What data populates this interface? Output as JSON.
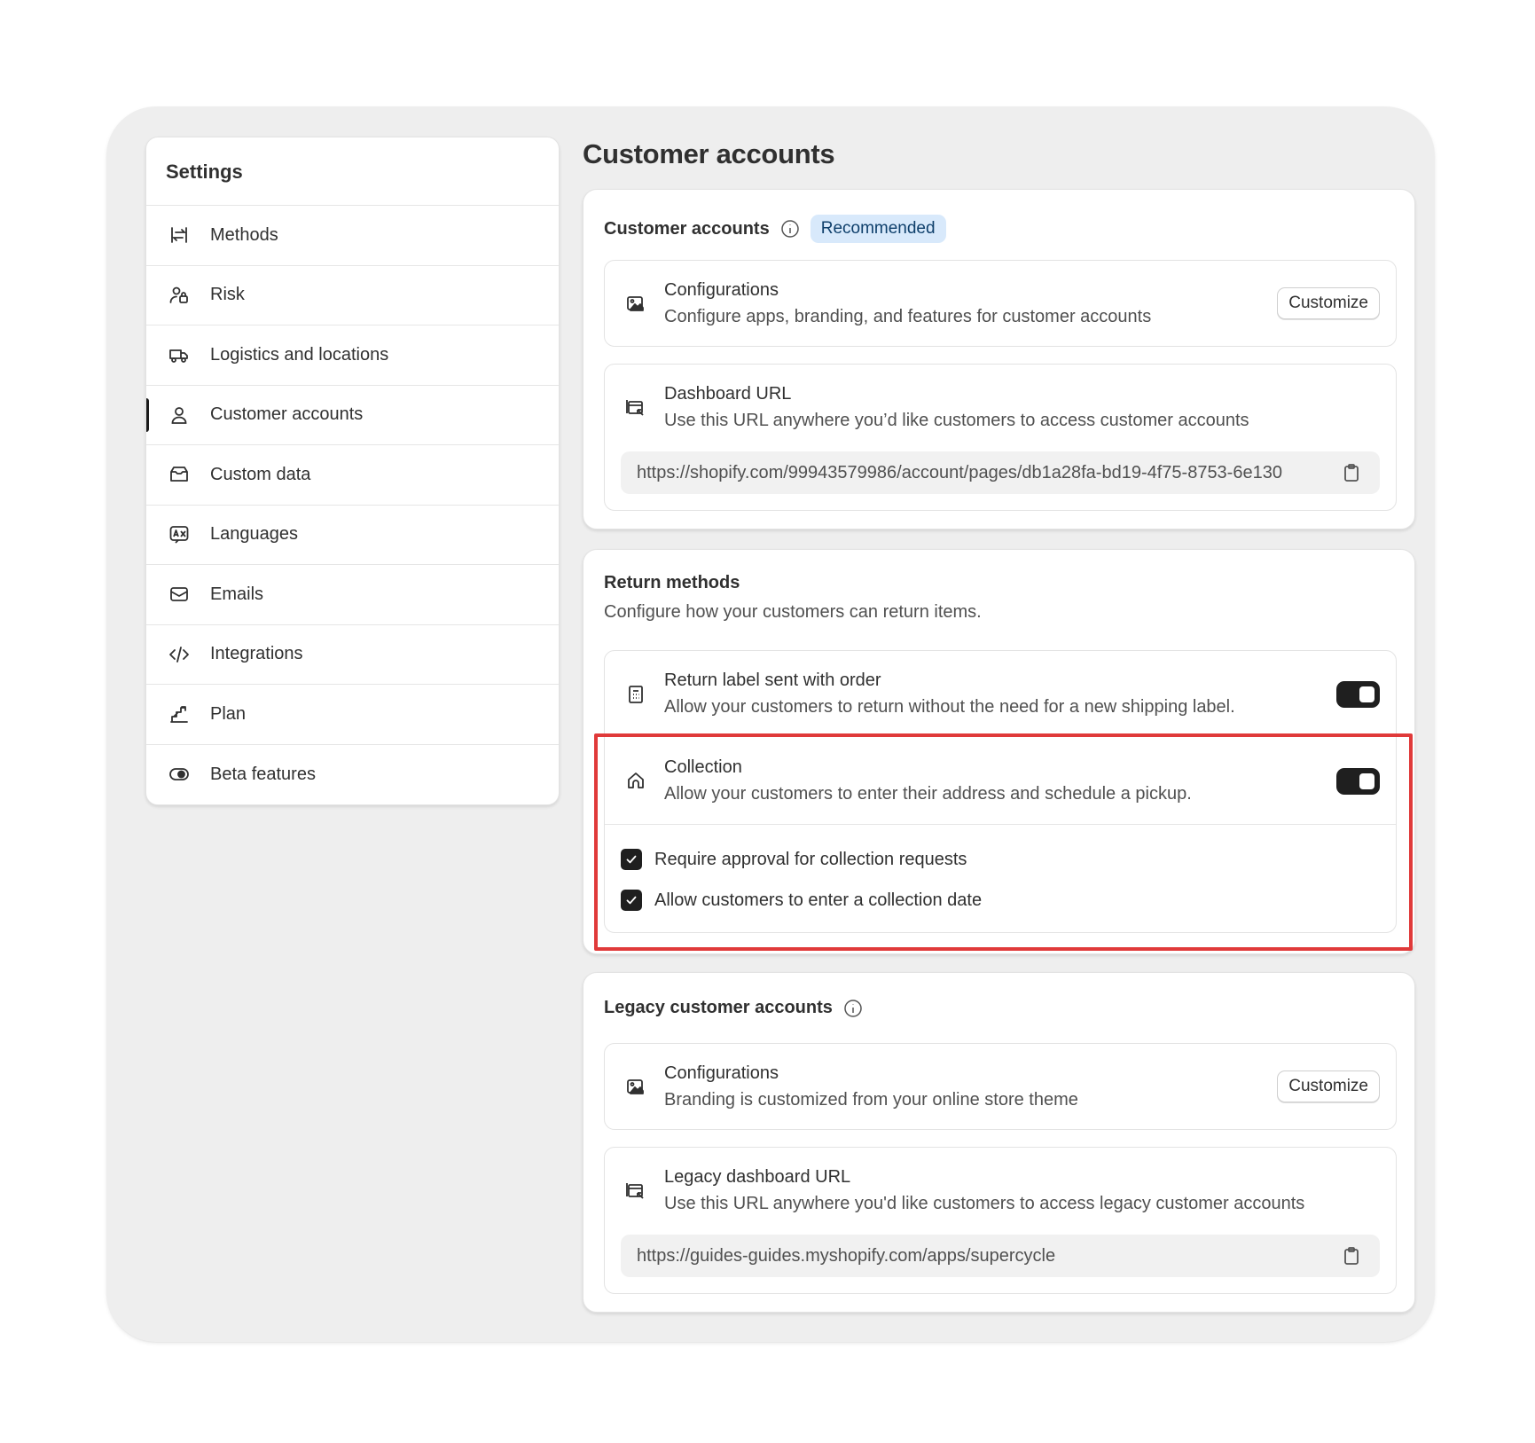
{
  "sidebar": {
    "title": "Settings",
    "items": [
      {
        "label": "Methods",
        "icon": "methods-icon"
      },
      {
        "label": "Risk",
        "icon": "risk-icon"
      },
      {
        "label": "Logistics and locations",
        "icon": "truck-icon"
      },
      {
        "label": "Customer accounts",
        "icon": "person-icon",
        "active": true
      },
      {
        "label": "Custom data",
        "icon": "custom-data-icon"
      },
      {
        "label": "Languages",
        "icon": "language-icon"
      },
      {
        "label": "Emails",
        "icon": "email-icon"
      },
      {
        "label": "Integrations",
        "icon": "code-icon"
      },
      {
        "label": "Plan",
        "icon": "plan-icon"
      },
      {
        "label": "Beta features",
        "icon": "toggle-icon"
      }
    ]
  },
  "page": {
    "title": "Customer accounts"
  },
  "customer_accounts": {
    "heading": "Customer accounts",
    "badge": "Recommended",
    "config": {
      "title": "Configurations",
      "description": "Configure apps, branding, and features for customer accounts",
      "button": "Customize"
    },
    "dashboard": {
      "title": "Dashboard URL",
      "description": "Use this URL anywhere you’d like customers to access customer accounts",
      "url": "https://shopify.com/99943579986/account/pages/db1a28fa-bd19-4f75-8753-6e130"
    }
  },
  "return_methods": {
    "heading": "Return methods",
    "description": "Configure how your customers can return items.",
    "return_label": {
      "title": "Return label sent with order",
      "description": "Allow your customers to return without the need for a new shipping label.",
      "enabled": true
    },
    "collection": {
      "title": "Collection",
      "description": "Allow your customers to enter their address and schedule a pickup.",
      "enabled": true,
      "options": [
        {
          "label": "Require approval for collection requests",
          "checked": true
        },
        {
          "label": "Allow customers to enter a collection date",
          "checked": true
        }
      ]
    }
  },
  "legacy": {
    "heading": "Legacy customer accounts",
    "config": {
      "title": "Configurations",
      "description": "Branding is customized from your online store theme",
      "button": "Customize"
    },
    "dashboard": {
      "title": "Legacy dashboard URL",
      "description": "Use this URL anywhere you'd like customers to access legacy customer accounts",
      "url": "https://guides-guides.myshopify.com/apps/supercycle"
    }
  },
  "colors": {
    "highlight": "#e03a3a",
    "badge_bg": "#d8e9fb",
    "toggle_on": "#1f1f1f"
  }
}
